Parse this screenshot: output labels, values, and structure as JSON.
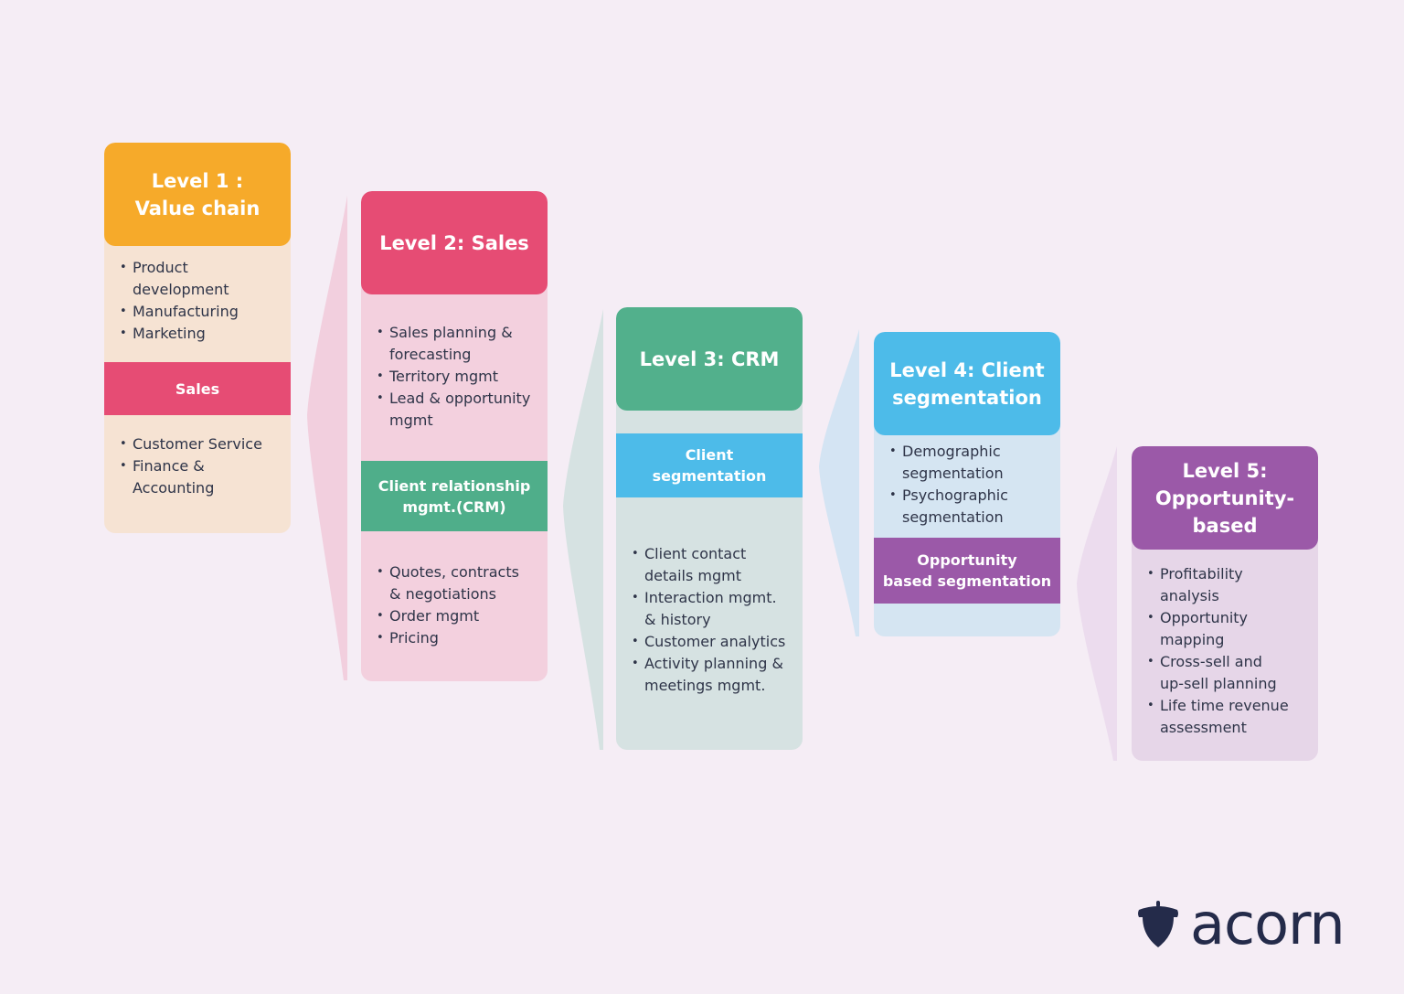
{
  "levels": [
    {
      "title": "Level 1 :\nValue chain",
      "title_lines": [
        "Level 1 :",
        "Value chain"
      ],
      "colors": {
        "header": "#f6aa2a",
        "body": "#f6e3d3"
      },
      "top_items": [
        "Product development",
        "Manufacturing",
        "Marketing"
      ],
      "band": {
        "label": "Sales",
        "color": "#e64c74"
      },
      "bottom_items": [
        "Customer Service",
        "Finance & Accounting"
      ]
    },
    {
      "title_lines": [
        "Level 2: Sales"
      ],
      "colors": {
        "header": "#e64c74",
        "body": "#f3d0de",
        "wedge": "#f2cfde"
      },
      "top_items": [
        "Sales planning & forecasting",
        "Territory mgmt",
        "Lead & opportunity mgmt"
      ],
      "band": {
        "label_lines": [
          "Client relationship",
          "mgmt.(CRM)"
        ],
        "color": "#4fae8a"
      },
      "bottom_items": [
        "Quotes, contracts & negotiations",
        "Order mgmt",
        "Pricing"
      ]
    },
    {
      "title_lines": [
        "Level 3: CRM"
      ],
      "colors": {
        "header": "#52b08c",
        "body": "#d6e2e2",
        "wedge": "#d6e2e2"
      },
      "band": {
        "label_lines": [
          "Client",
          "segmentation"
        ],
        "color": "#4dbbe9"
      },
      "bottom_items": [
        "Client contact details mgmt",
        "Interaction mgmt. & history",
        "Customer analytics",
        "Activity planning & meetings mgmt."
      ]
    },
    {
      "title_lines": [
        "Level 4: Client",
        "segmentation"
      ],
      "colors": {
        "header": "#4dbbe9",
        "body": "#d5e5f2",
        "wedge": "#d4e4f3"
      },
      "top_items": [
        "Demographic segmentation",
        "Psychographic segmentation"
      ],
      "band": {
        "label_lines": [
          "Opportunity",
          "based segmentation"
        ],
        "color": "#9b59a8"
      }
    },
    {
      "title_lines": [
        "Level 5:",
        "Opportunity-",
        "based"
      ],
      "colors": {
        "header": "#9b59a8",
        "body": "#e6d6e8",
        "wedge": "#ecdcee"
      },
      "top_items": [
        "Profitability analysis",
        "Opportunity mapping",
        "Cross-sell and up-sell planning",
        "Life time revenue assessment"
      ]
    }
  ],
  "logo": {
    "text": "acorn",
    "icon": "acorn-icon",
    "color": "#242b4a"
  },
  "background": "#f5edf5"
}
